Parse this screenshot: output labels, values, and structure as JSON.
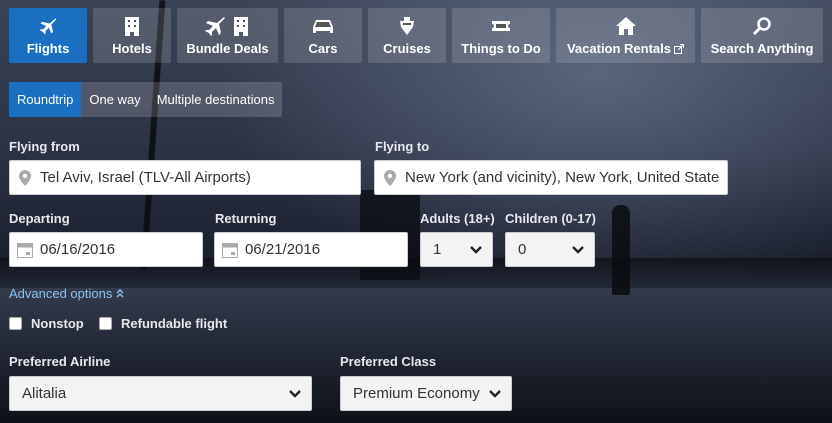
{
  "tabs": [
    {
      "label": "Flights",
      "icon": "plane-icon",
      "active": true
    },
    {
      "label": "Hotels",
      "icon": "building-icon"
    },
    {
      "label": "Bundle Deals",
      "icon": "plane-building-icon"
    },
    {
      "label": "Cars",
      "icon": "car-icon"
    },
    {
      "label": "Cruises",
      "icon": "ship-icon"
    },
    {
      "label": "Things to Do",
      "icon": "ticket-icon"
    },
    {
      "label": "Vacation Rentals",
      "icon": "house-icon"
    },
    {
      "label": "Search Anything",
      "icon": "search-icon"
    }
  ],
  "trip_types": [
    "Roundtrip",
    "One way",
    "Multiple destinations"
  ],
  "form": {
    "from_label": "Flying from",
    "from_value": "Tel Aviv, Israel (TLV-All Airports)",
    "to_label": "Flying to",
    "to_value": "New York (and vicinity), New York, United State",
    "departing_label": "Departing",
    "departing_value": "06/16/2016",
    "returning_label": "Returning",
    "returning_value": "06/21/2016",
    "adults_label": "Adults (18+)",
    "adults_value": "1",
    "children_label": "Children (0-17)",
    "children_value": "0",
    "advanced_label": "Advanced options",
    "nonstop_label": "Nonstop",
    "refundable_label": "Refundable flight",
    "airline_label": "Preferred Airline",
    "airline_value": "Alitalia",
    "class_label": "Preferred Class",
    "class_value": "Premium Economy"
  },
  "colors": {
    "accent": "#1a6fc1",
    "link": "#8cc1f2"
  }
}
